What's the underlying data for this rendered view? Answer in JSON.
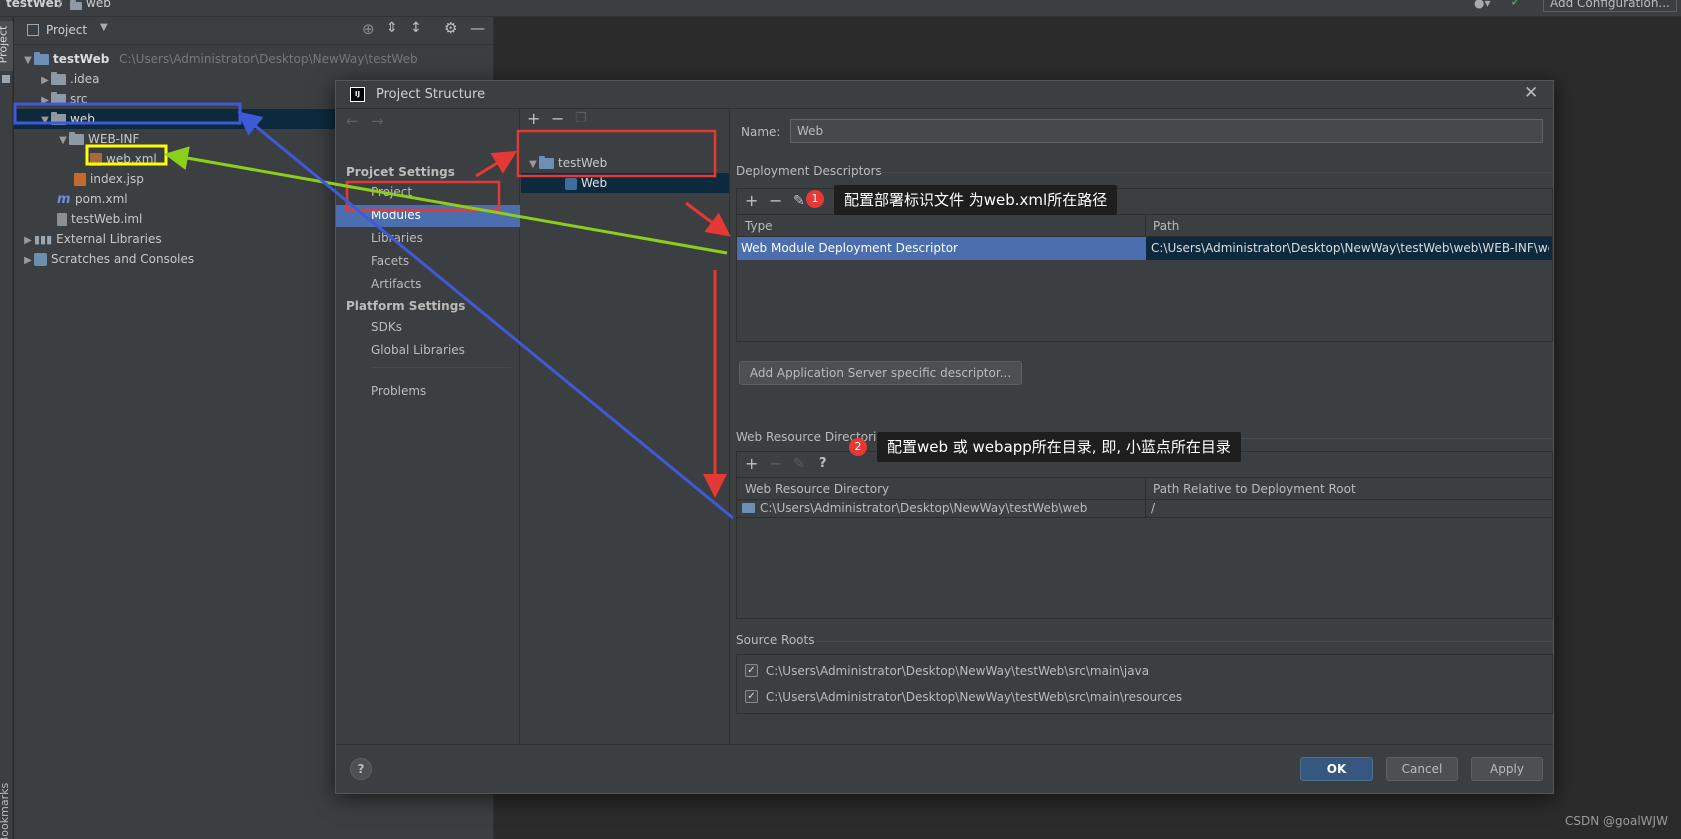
{
  "top_bar": {
    "breadcrumb_project": "testWeb",
    "breadcrumb_sep": "/",
    "breadcrumb_folder": "web",
    "add_config_label": "Add Configuration..."
  },
  "side_strip": {
    "project_label": "Project",
    "bookmarks_label": "Bookmarks"
  },
  "project_panel": {
    "title": "Project",
    "tree": [
      {
        "label": "testWeb",
        "hint": "C:\\Users\\Administrator\\Desktop\\NewWay\\testWeb"
      },
      {
        "label": ".idea"
      },
      {
        "label": "src"
      },
      {
        "label": "web"
      },
      {
        "label": "WEB-INF"
      },
      {
        "label": "web.xml"
      },
      {
        "label": "index.jsp"
      },
      {
        "label": "pom.xml"
      },
      {
        "label": "testWeb.iml"
      },
      {
        "label": "External Libraries"
      },
      {
        "label": "Scratches and Consoles"
      }
    ]
  },
  "dialog": {
    "title": "Project Structure",
    "close_icon": "close-icon",
    "nav": {
      "project_settings_header": "Projcet Settings",
      "project_settings": [
        "Project",
        "Modules",
        "Libraries",
        "Facets",
        "Artifacts"
      ],
      "platform_settings_header": "Platform Settings",
      "platform_settings": [
        "SDKs",
        "Global Libraries"
      ],
      "problems": "Problems"
    },
    "module_tree": {
      "root": "testWeb",
      "child": "Web"
    },
    "name_label": "Name:",
    "name_value": "Web",
    "deployment": {
      "header": "Deployment Descriptors",
      "col_type": "Type",
      "col_path": "Path",
      "row_type": "Web Module Deployment Descriptor",
      "row_path": "C:\\Users\\Administrator\\Desktop\\NewWay\\testWeb\\web\\WEB-INF\\we",
      "add_server_btn": "Add Application Server specific descriptor..."
    },
    "web_resource": {
      "header": "Web Resource Directories",
      "col_dir": "Web Resource Directory",
      "col_rel": "Path Relative to Deployment Root",
      "row_dir": "C:\\Users\\Administrator\\Desktop\\NewWay\\testWeb\\web",
      "row_rel": "/"
    },
    "source_roots": {
      "header": "Source Roots",
      "items": [
        "C:\\Users\\Administrator\\Desktop\\NewWay\\testWeb\\src\\main\\java",
        "C:\\Users\\Administrator\\Desktop\\NewWay\\testWeb\\src\\main\\resources"
      ]
    },
    "help": "?",
    "ok": "OK",
    "cancel": "Cancel",
    "apply": "Apply"
  },
  "annotations": {
    "badge1": "1",
    "callout1": "配置部署标识文件 为web.xml所在路径",
    "badge2": "2",
    "callout2": "配置web 或 webapp所在目录, 即, 小蓝点所在目录"
  },
  "watermark": "CSDN @goalWJW",
  "colors": {
    "selection": "#4b6eaf",
    "tree_selection": "#0d293e",
    "annotation_red": "#e53935",
    "annotation_blue": "#3f5ad8",
    "annotation_green": "#8ccf1a",
    "annotation_yellow": "#ffff00"
  }
}
